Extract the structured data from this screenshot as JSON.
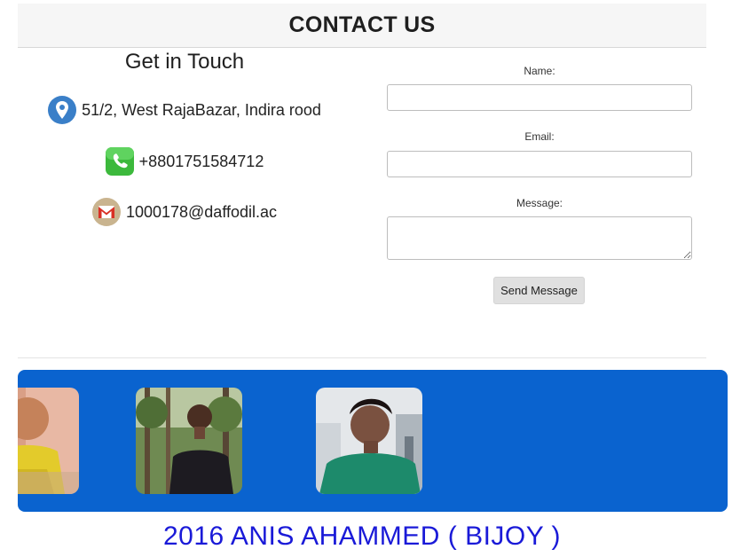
{
  "header": {
    "title": "CONTACT US"
  },
  "info": {
    "title": "Get in Touch",
    "address": {
      "icon": "location-pin-icon",
      "text": "51/2, West RajaBazar, Indira rood"
    },
    "phone": {
      "icon": "phone-icon",
      "text": "+8801751584712"
    },
    "email": {
      "icon": "gmail-icon",
      "text": "1000178@daffodil.ac"
    }
  },
  "form": {
    "name_label": "Name:",
    "email_label": "Email:",
    "message_label": "Message:",
    "name_value": "",
    "email_value": "",
    "message_value": "",
    "submit_label": "Send Message"
  },
  "gallery": {
    "background": "#0a63cf",
    "photos": [
      "person-photo-yellow-shirt",
      "person-photo-forest",
      "person-photo-green-shirt"
    ]
  },
  "footer": {
    "text": "2016 ANIS AHAMMED ( BIJOY )",
    "color": "#1a1ad8"
  }
}
